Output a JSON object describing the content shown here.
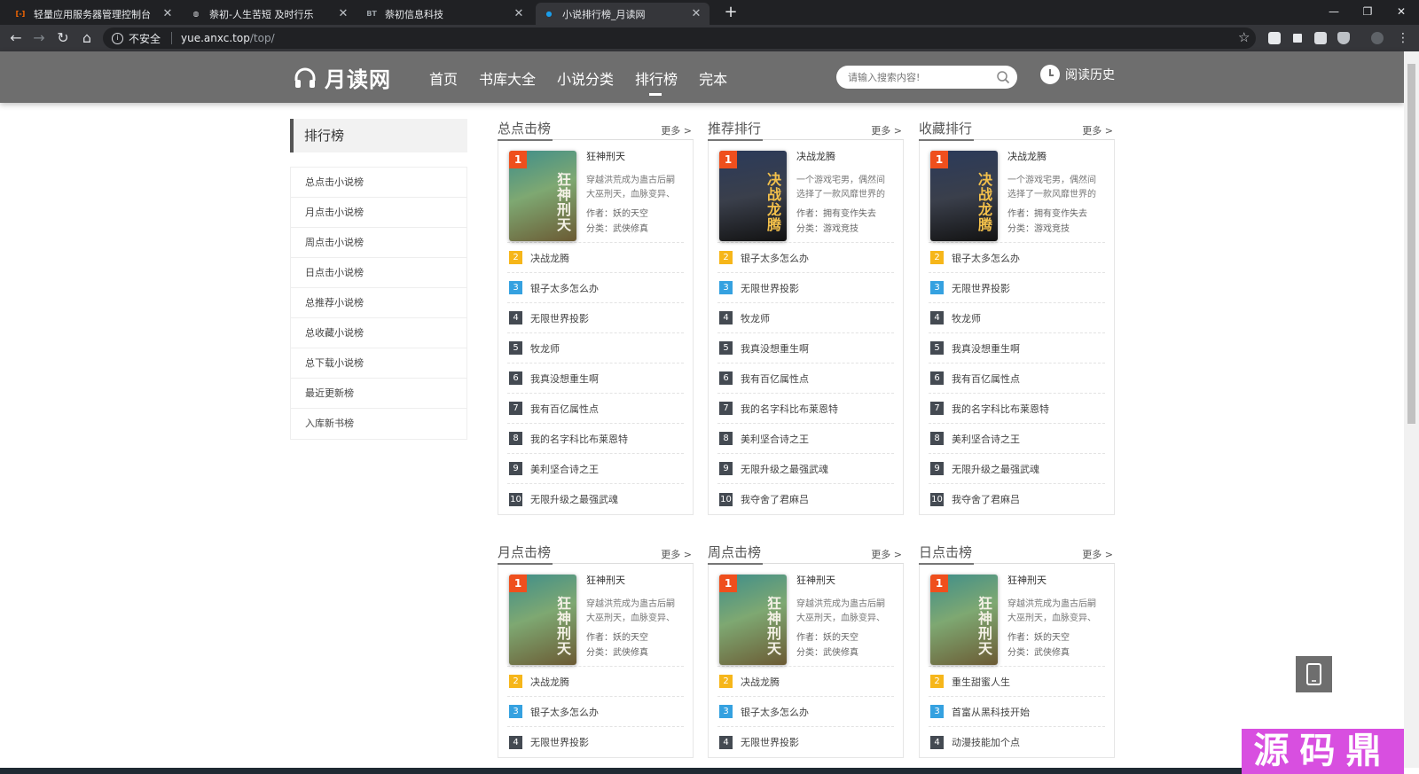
{
  "browser": {
    "tabs": [
      {
        "title": "轻量应用服务器管理控制台",
        "favicon": "aliyun-icon",
        "fav_color": "#ff6a00",
        "fav_text": "[-]"
      },
      {
        "title": "萘初-人生苦短 及时行乐",
        "favicon": "globe-icon",
        "fav_color": "#dadce0",
        "fav_text": "◍"
      },
      {
        "title": "萘初信息科技",
        "favicon": "bt-icon",
        "fav_color": "#9aa0a6",
        "fav_text": "BT"
      },
      {
        "title": "小说排行榜_月读网",
        "favicon": "yuedu-icon",
        "fav_color": "#1a9dea",
        "fav_text": "●"
      }
    ],
    "security_label": "不安全",
    "url_host": "yue.anxc.top",
    "url_path": "/top/"
  },
  "site": {
    "logo": "月读网",
    "nav": [
      "首页",
      "书库大全",
      "小说分类",
      "排行榜",
      "完本"
    ],
    "active_nav": "排行榜",
    "search_placeholder": "请输入搜索内容!",
    "history_label": "阅读历史"
  },
  "sidebar": {
    "title": "排行榜",
    "items": [
      "总点击小说榜",
      "月点击小说榜",
      "周点击小说榜",
      "日点击小说榜",
      "总推荐小说榜",
      "总收藏小说榜",
      "总下载小说榜",
      "最近更新榜",
      "入库新书榜"
    ]
  },
  "more_label": "更多 >",
  "author_prefix": "作者：",
  "category_prefix": "分类：",
  "boxes": [
    {
      "title": "总点击榜",
      "top": {
        "rank": "1",
        "title": "狂神刑天",
        "desc": "穿越洪荒成为蛊古后嗣大巫刑天，血脉变异、",
        "author": "妖的天空",
        "category": "武侠修真",
        "cover_text": "狂神刑天"
      },
      "items": [
        {
          "rank": "2",
          "name": "决战龙腾"
        },
        {
          "rank": "3",
          "name": "银子太多怎么办"
        },
        {
          "rank": "4",
          "name": "无限世界投影"
        },
        {
          "rank": "5",
          "name": "牧龙师"
        },
        {
          "rank": "6",
          "name": "我真没想重生啊"
        },
        {
          "rank": "7",
          "name": "我有百亿属性点"
        },
        {
          "rank": "8",
          "name": "我的名字科比布莱恩特"
        },
        {
          "rank": "9",
          "name": "美利坚合诗之王"
        },
        {
          "rank": "10",
          "name": "无限升级之最强武魂"
        }
      ]
    },
    {
      "title": "推荐排行",
      "top": {
        "rank": "1",
        "title": "决战龙腾",
        "desc": "一个游戏宅男，偶然间选择了一款风靡世界的",
        "author": "拥有变作失去",
        "category": "游戏竞技",
        "cover_text": "决战龙腾"
      },
      "items": [
        {
          "rank": "2",
          "name": "银子太多怎么办"
        },
        {
          "rank": "3",
          "name": "无限世界投影"
        },
        {
          "rank": "4",
          "name": "牧龙师"
        },
        {
          "rank": "5",
          "name": "我真没想重生啊"
        },
        {
          "rank": "6",
          "name": "我有百亿属性点"
        },
        {
          "rank": "7",
          "name": "我的名字科比布莱恩特"
        },
        {
          "rank": "8",
          "name": "美利坚合诗之王"
        },
        {
          "rank": "9",
          "name": "无限升级之最强武魂"
        },
        {
          "rank": "10",
          "name": "我夺舍了君麻吕"
        }
      ]
    },
    {
      "title": "收藏排行",
      "top": {
        "rank": "1",
        "title": "决战龙腾",
        "desc": "一个游戏宅男，偶然间选择了一款风靡世界的",
        "author": "拥有变作失去",
        "category": "游戏竞技",
        "cover_text": "决战龙腾"
      },
      "items": [
        {
          "rank": "2",
          "name": "银子太多怎么办"
        },
        {
          "rank": "3",
          "name": "无限世界投影"
        },
        {
          "rank": "4",
          "name": "牧龙师"
        },
        {
          "rank": "5",
          "name": "我真没想重生啊"
        },
        {
          "rank": "6",
          "name": "我有百亿属性点"
        },
        {
          "rank": "7",
          "name": "我的名字科比布莱恩特"
        },
        {
          "rank": "8",
          "name": "美利坚合诗之王"
        },
        {
          "rank": "9",
          "name": "无限升级之最强武魂"
        },
        {
          "rank": "10",
          "name": "我夺舍了君麻吕"
        }
      ]
    },
    {
      "title": "月点击榜",
      "top": {
        "rank": "1",
        "title": "狂神刑天",
        "desc": "穿越洪荒成为蛊古后嗣大巫刑天，血脉变异、",
        "author": "妖的天空",
        "category": "武侠修真",
        "cover_text": "狂神刑天"
      },
      "items": [
        {
          "rank": "2",
          "name": "决战龙腾"
        },
        {
          "rank": "3",
          "name": "银子太多怎么办"
        },
        {
          "rank": "4",
          "name": "无限世界投影"
        }
      ]
    },
    {
      "title": "周点击榜",
      "top": {
        "rank": "1",
        "title": "狂神刑天",
        "desc": "穿越洪荒成为蛊古后嗣大巫刑天，血脉变异、",
        "author": "妖的天空",
        "category": "武侠修真",
        "cover_text": "狂神刑天"
      },
      "items": [
        {
          "rank": "2",
          "name": "决战龙腾"
        },
        {
          "rank": "3",
          "name": "银子太多怎么办"
        },
        {
          "rank": "4",
          "name": "无限世界投影"
        }
      ]
    },
    {
      "title": "日点击榜",
      "top": {
        "rank": "1",
        "title": "狂神刑天",
        "desc": "穿越洪荒成为蛊古后嗣大巫刑天，血脉变异、",
        "author": "妖的天空",
        "category": "武侠修真",
        "cover_text": "狂神刑天"
      },
      "items": [
        {
          "rank": "2",
          "name": "重生甜蜜人生"
        },
        {
          "rank": "3",
          "name": "首富从黑科技开始"
        },
        {
          "rank": "4",
          "name": "动漫技能加个点"
        }
      ]
    }
  ],
  "watermark": "源码鼎",
  "colors": {
    "header_bg": "#6e6e6e",
    "rank1": "#ef4f1d",
    "rank2": "#f6b61a",
    "rank3": "#35a1e0",
    "rank_other": "#444a52",
    "watermark": "#d84fe0"
  }
}
